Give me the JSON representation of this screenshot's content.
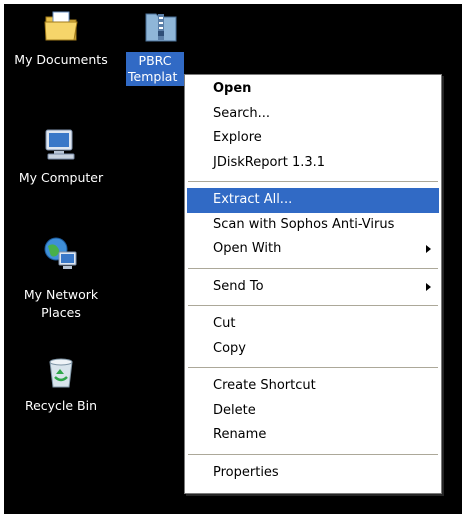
{
  "desktop": {
    "icons": [
      {
        "label": "My Documents",
        "icon": "folder-documents-icon"
      },
      {
        "label": "PBRC Template",
        "icon": "zip-folder-icon"
      },
      {
        "label": "My Computer",
        "icon": "computer-icon"
      },
      {
        "label": "My Network Places",
        "icon": "network-places-icon"
      },
      {
        "label": "Recycle Bin",
        "icon": "recycle-bin-icon"
      }
    ],
    "zip_label_line1": "PBRC",
    "zip_label_line2": "Templat"
  },
  "context_menu": {
    "items": [
      {
        "label": "Open",
        "bold": true
      },
      {
        "label": "Search..."
      },
      {
        "label": "Explore"
      },
      {
        "label": "JDiskReport 1.3.1"
      },
      {
        "label": "Extract All...",
        "highlighted": true
      },
      {
        "label": "Scan with Sophos Anti-Virus"
      },
      {
        "label": "Open With",
        "submenu": true
      },
      {
        "label": "Send To",
        "submenu": true
      },
      {
        "label": "Cut"
      },
      {
        "label": "Copy"
      },
      {
        "label": "Create Shortcut"
      },
      {
        "label": "Delete"
      },
      {
        "label": "Rename"
      },
      {
        "label": "Properties"
      }
    ]
  },
  "colors": {
    "desktop_background": "#000000",
    "selection": "#316ac5",
    "menu_background": "#ffffff"
  }
}
